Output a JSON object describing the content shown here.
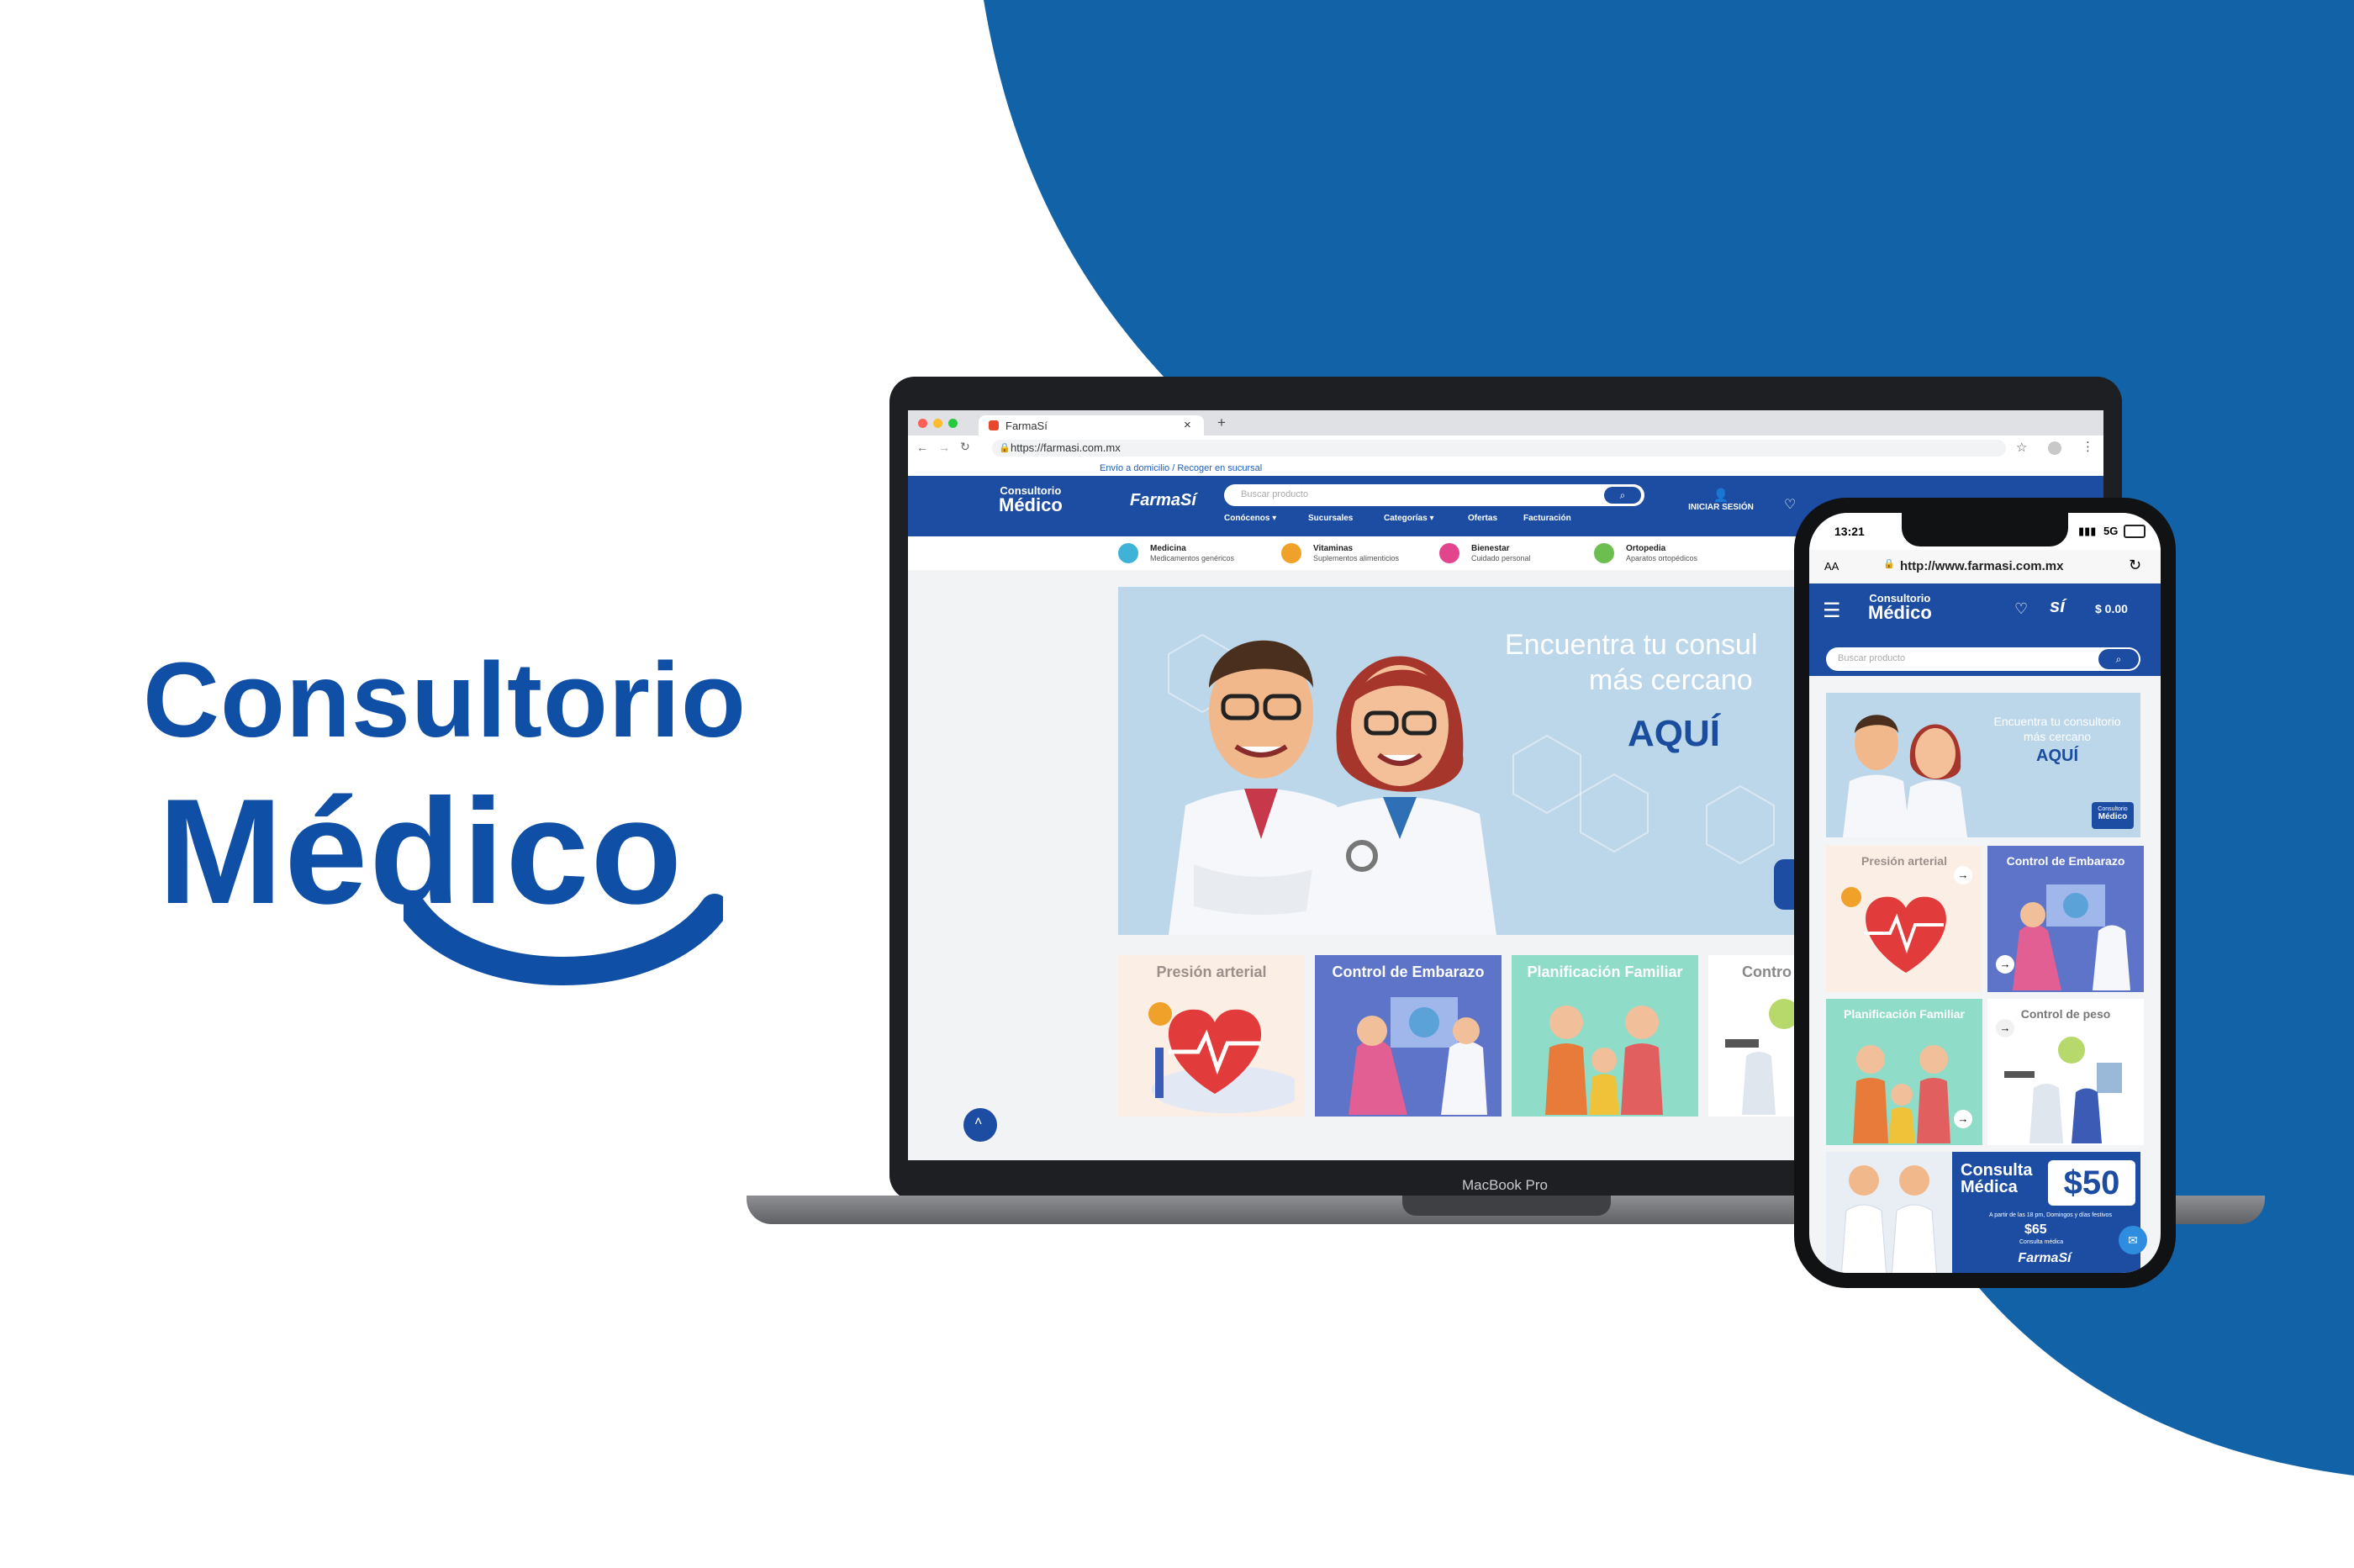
{
  "brand": {
    "logo_line1": "Consultorio",
    "logo_line2": "Médico",
    "colors": {
      "primary": "#0f4fa6",
      "nav": "#1c4da2",
      "accent_bg": "#1262a8"
    }
  },
  "laptop": {
    "model_label": "MacBook Pro",
    "browser": {
      "tab_title": "FarmaSí",
      "url": "https://farmasi.com.mx",
      "new_tab": "+",
      "close_tab": "×"
    },
    "site": {
      "topbar_text": "Envío a domicilio / Recoger en sucursal",
      "logo_line1": "Consultorio",
      "logo_line2": "Médico",
      "farmasi_logo": "FarmaSí",
      "search_placeholder": "Buscar producto",
      "login_label": "INICIAR SESIÓN",
      "nav_items": [
        "Conócenos ▾",
        "Sucursales",
        "Categorías ▾",
        "Ofertas",
        "Facturación"
      ],
      "categories": [
        {
          "title": "Medicina",
          "subtitle": "Medicamentos genéricos",
          "color": "#3fb3d7"
        },
        {
          "title": "Vitaminas",
          "subtitle": "Suplementos alimenticios",
          "color": "#f0a12a"
        },
        {
          "title": "Bienestar",
          "subtitle": "Cuidado personal",
          "color": "#e2458c"
        },
        {
          "title": "Ortopedia",
          "subtitle": "Aparatos ortopédicos",
          "color": "#6cbf4f"
        }
      ],
      "hero": {
        "line1": "Encuentra tu consul",
        "line2": "más cercano",
        "cta": "AQUÍ"
      },
      "cards": [
        {
          "title": "Presión arterial",
          "bg": "#fbeee4",
          "fg": "#9a8f8a"
        },
        {
          "title": "Control de Embarazo",
          "bg": "#5e74c9",
          "fg": "#ffffff"
        },
        {
          "title": "Planificación Familiar",
          "bg": "#8fdcc9",
          "fg": "#ffffff"
        },
        {
          "title": "Contro",
          "bg": "#ffffff",
          "fg": "#888888"
        }
      ]
    }
  },
  "phone": {
    "time": "13:21",
    "network": "5G",
    "text_size": "AA",
    "url": "http://www.farmasi.com.mx",
    "logo_line1": "Consultorio",
    "logo_line2": "Médico",
    "cart_total": "$ 0.00",
    "search_placeholder": "Buscar producto",
    "hero": {
      "line1": "Encuentra tu consultorio",
      "line2": "más cercano",
      "cta": "AQUÍ",
      "badge_line1": "Consultorio",
      "badge_line2": "Médico"
    },
    "cards": [
      {
        "title": "Presión arterial",
        "bg": "#fbeee4",
        "fg": "#9a8f8a"
      },
      {
        "title": "Control de Embarazo",
        "bg": "#5e74c9",
        "fg": "#ffffff"
      },
      {
        "title": "Planificación Familiar",
        "bg": "#8fdcc9",
        "fg": "#ffffff"
      },
      {
        "title": "Control de peso",
        "bg": "#ffffff",
        "fg": "#777777"
      }
    ],
    "promo": {
      "line1": "Consulta",
      "line2": "Médica",
      "price": "$50",
      "note": "A partir de las 18 pm, Domingos y días festivos",
      "price2": "$65",
      "note2": "Consulta médica",
      "logo": "FarmaSí"
    }
  }
}
